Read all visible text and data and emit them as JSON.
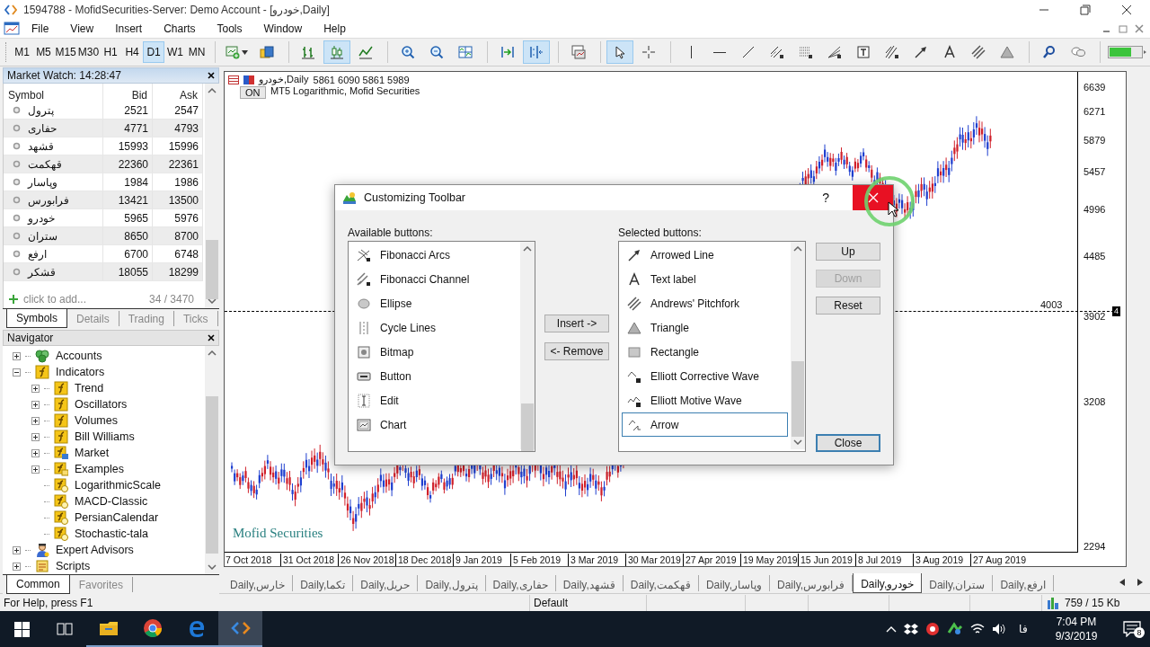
{
  "window": {
    "title": "1594788 - MofidSecurities-Server: Demo Account - [خودرو,Daily]"
  },
  "menu": [
    "File",
    "View",
    "Insert",
    "Charts",
    "Tools",
    "Window",
    "Help"
  ],
  "timeframes": [
    {
      "label": "M1",
      "selected": false
    },
    {
      "label": "M5",
      "selected": false
    },
    {
      "label": "M15",
      "selected": false
    },
    {
      "label": "M30",
      "selected": false
    },
    {
      "label": "H1",
      "selected": false
    },
    {
      "label": "H4",
      "selected": false
    },
    {
      "label": "D1",
      "selected": true
    },
    {
      "label": "W1",
      "selected": false
    },
    {
      "label": "MN",
      "selected": false
    }
  ],
  "tool_buttons": [
    {
      "kind": "new-chart",
      "selected": false
    },
    {
      "kind": "profiles",
      "selected": false
    },
    {
      "kind": "bars",
      "selected": false
    },
    {
      "kind": "candles",
      "selected": true
    },
    {
      "kind": "line",
      "selected": false
    },
    {
      "kind": "zoom-in",
      "selected": false
    },
    {
      "kind": "zoom-out",
      "selected": false
    },
    {
      "kind": "tile",
      "selected": false
    },
    {
      "kind": "autoscroll",
      "selected": false
    },
    {
      "kind": "shift",
      "selected": true
    },
    {
      "kind": "templates",
      "selected": false
    },
    {
      "kind": "cursor",
      "selected": true
    },
    {
      "kind": "crosshair",
      "selected": false
    },
    {
      "kind": "vline",
      "selected": false
    },
    {
      "kind": "hline",
      "selected": false
    },
    {
      "kind": "trendline",
      "selected": false
    },
    {
      "kind": "channel",
      "selected": false
    },
    {
      "kind": "fibo",
      "selected": false
    },
    {
      "kind": "fan",
      "selected": false
    },
    {
      "kind": "textbox",
      "selected": false
    },
    {
      "kind": "gann",
      "selected": false
    },
    {
      "kind": "arrowed",
      "selected": false
    },
    {
      "kind": "label",
      "selected": false
    },
    {
      "kind": "pitchfork",
      "selected": false
    },
    {
      "kind": "triangle",
      "selected": false
    },
    {
      "kind": "search",
      "selected": false
    },
    {
      "kind": "chat",
      "selected": false
    },
    {
      "kind": "signal",
      "selected": false
    }
  ],
  "market_watch": {
    "title": "Market Watch: 14:28:47",
    "columns": [
      "Symbol",
      "Bid",
      "Ask"
    ],
    "rows": [
      {
        "symbol": "پترول",
        "bid": "2521",
        "ask": "2547"
      },
      {
        "symbol": "حفاری",
        "bid": "4771",
        "ask": "4793"
      },
      {
        "symbol": "قشهد",
        "bid": "15993",
        "ask": "15996"
      },
      {
        "symbol": "قهکمت",
        "bid": "22360",
        "ask": "22361"
      },
      {
        "symbol": "وپاسار",
        "bid": "1984",
        "ask": "1986"
      },
      {
        "symbol": "فرابورس",
        "bid": "13421",
        "ask": "13500"
      },
      {
        "symbol": "خودرو",
        "bid": "5965",
        "ask": "5976"
      },
      {
        "symbol": "ستران",
        "bid": "8650",
        "ask": "8700"
      },
      {
        "symbol": "ارفع",
        "bid": "6700",
        "ask": "6748"
      },
      {
        "symbol": "قشکر",
        "bid": "18055",
        "ask": "18299"
      }
    ],
    "add_label": "click to add...",
    "count": "34 / 3470",
    "tabs": [
      {
        "label": "Symbols",
        "selected": true
      },
      {
        "label": "Details",
        "selected": false
      },
      {
        "label": "Trading",
        "selected": false
      },
      {
        "label": "Ticks",
        "selected": false
      }
    ]
  },
  "navigator": {
    "title": "Navigator",
    "tree": [
      {
        "label": "Accounts",
        "kind": "accounts",
        "expanded": false
      },
      {
        "label": "Indicators",
        "kind": "indicators",
        "expanded": true,
        "children": [
          {
            "label": "Trend",
            "kind": "category",
            "expanded": false
          },
          {
            "label": "Oscillators",
            "kind": "category",
            "expanded": false
          },
          {
            "label": "Volumes",
            "kind": "category",
            "expanded": false
          },
          {
            "label": "Bill Williams",
            "kind": "category",
            "expanded": false
          },
          {
            "label": "Market",
            "kind": "market",
            "expanded": false
          },
          {
            "label": "Examples",
            "kind": "examples",
            "expanded": false
          },
          {
            "label": "LogarithmicScale",
            "kind": "custom"
          },
          {
            "label": "MACD-Classic",
            "kind": "custom"
          },
          {
            "label": "PersianCalendar",
            "kind": "custom"
          },
          {
            "label": "Stochastic-tala",
            "kind": "custom"
          }
        ]
      },
      {
        "label": "Expert Advisors",
        "kind": "experts",
        "expanded": false
      },
      {
        "label": "Scripts",
        "kind": "scripts",
        "expanded": false
      }
    ],
    "tabs": [
      {
        "label": "Common",
        "selected": true
      },
      {
        "label": "Favorites",
        "selected": false
      }
    ]
  },
  "chart": {
    "symbol": "خودرو,Daily",
    "prices": "5861 6090 5861 5989",
    "toggle": "ON",
    "indicator": "MT5 Logarithmic, Mofid Securities",
    "price_labels": [
      "6639",
      "6271",
      "5879",
      "5457",
      "4996",
      "4485",
      "3902",
      "3208",
      "2294"
    ],
    "level_line": {
      "label": "4003",
      "marker": "4"
    },
    "dates": [
      "7 Oct 2018",
      "31 Oct 2018",
      "26 Nov 2018",
      "18 Dec 2018",
      "9 Jan 2019",
      "5 Feb 2019",
      "3 Mar 2019",
      "30 Mar 2019",
      "27 Apr 2019",
      "19 May 2019",
      "15 Jun 2019",
      "8 Jul 2019",
      "3 Aug 2019",
      "27 Aug 2019"
    ],
    "brand": "Mofid Securities"
  },
  "chart_tabs": [
    {
      "label": "Daily,خارس",
      "selected": false
    },
    {
      "label": "Daily,تکما",
      "selected": false
    },
    {
      "label": "Daily,حریل",
      "selected": false
    },
    {
      "label": "Daily,پترول",
      "selected": false
    },
    {
      "label": "Daily,حفاری",
      "selected": false
    },
    {
      "label": "Daily,قشهد",
      "selected": false
    },
    {
      "label": "Daily,قهکمت",
      "selected": false
    },
    {
      "label": "Daily,وپاسار",
      "selected": false
    },
    {
      "label": "Daily,فرابورس",
      "selected": false
    },
    {
      "label": "Daily,خودرو",
      "selected": true
    },
    {
      "label": "Daily,ستران",
      "selected": false
    },
    {
      "label": "Daily,ارفع",
      "selected": false
    }
  ],
  "dialog": {
    "title": "Customizing Toolbar",
    "help": "?",
    "available_label": "Available buttons:",
    "selected_label": "Selected buttons:",
    "available": [
      {
        "label": "Fibonacci Arcs",
        "kind": "fibo-arcs",
        "selected": false
      },
      {
        "label": "Fibonacci Channel",
        "kind": "fibo-channel",
        "selected": false
      },
      {
        "label": "Ellipse",
        "kind": "ellipse",
        "selected": false
      },
      {
        "label": "Cycle Lines",
        "kind": "cycle",
        "selected": false
      },
      {
        "label": "Bitmap",
        "kind": "bitmap",
        "selected": false
      },
      {
        "label": "Button",
        "kind": "button",
        "selected": false
      },
      {
        "label": "Edit",
        "kind": "edit",
        "selected": false
      },
      {
        "label": "Chart",
        "kind": "chart",
        "selected": false
      }
    ],
    "selected": [
      {
        "label": "Arrowed Line",
        "kind": "arrowed",
        "selected": false
      },
      {
        "label": "Text label",
        "kind": "label",
        "selected": false
      },
      {
        "label": "Andrews' Pitchfork",
        "kind": "pitchfork",
        "selected": false
      },
      {
        "label": "Triangle",
        "kind": "triangle",
        "selected": false
      },
      {
        "label": "Rectangle",
        "kind": "rectangle",
        "selected": false
      },
      {
        "label": "Elliott Corrective Wave",
        "kind": "elliott-c",
        "selected": false
      },
      {
        "label": "Elliott Motive Wave",
        "kind": "elliott-m",
        "selected": false
      },
      {
        "label": "Arrow",
        "kind": "arrow",
        "selected": true
      }
    ],
    "insert": "Insert ->",
    "remove": "<- Remove",
    "side_buttons": [
      {
        "label": "Up",
        "disabled": false
      },
      {
        "label": "Down",
        "disabled": true
      },
      {
        "label": "Reset",
        "disabled": false
      }
    ],
    "close": "Close"
  },
  "status_bar": {
    "help": "For Help, press F1",
    "profile": "Default",
    "traffic": "759 / 15 Kb"
  },
  "taskbar": {
    "apps": [
      {
        "kind": "folder",
        "active": false
      },
      {
        "kind": "chrome",
        "active": false
      },
      {
        "kind": "edge",
        "active": false
      },
      {
        "kind": "terminal",
        "active": true
      }
    ],
    "language": "فا",
    "time": "7:04 PM",
    "date": "9/3/2019",
    "notifications": "8"
  }
}
